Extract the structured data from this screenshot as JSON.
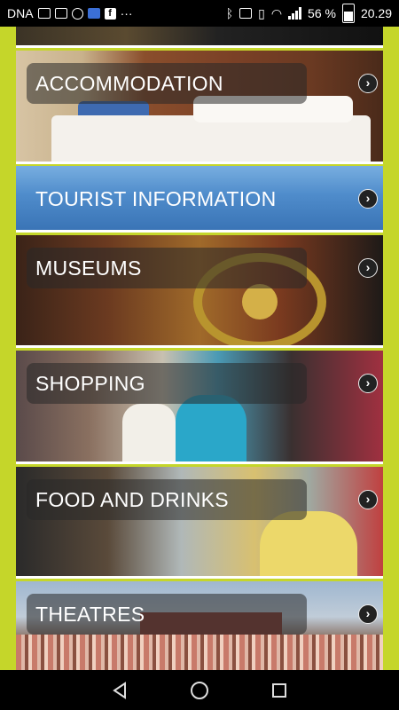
{
  "status_bar": {
    "carrier": "DNA",
    "battery_percent": "56 %",
    "time": "20.29"
  },
  "menu": {
    "items": [
      {
        "label": "ACCOMMODATION",
        "arrow": "›"
      },
      {
        "label": "TOURIST INFORMATION",
        "arrow": "›"
      },
      {
        "label": "MUSEUMS",
        "arrow": "›"
      },
      {
        "label": "SHOPPING",
        "arrow": "›"
      },
      {
        "label": "FOOD AND DRINKS",
        "arrow": "›"
      },
      {
        "label": "THEATRES",
        "arrow": "›"
      }
    ]
  },
  "nav_bar": {
    "back_icon": "triangle-back-icon",
    "home_icon": "circle-home-icon",
    "recents_icon": "square-recents-icon"
  },
  "colors": {
    "side_accent": "#c5d62a",
    "tourist_blue": "#4f8ccb"
  }
}
